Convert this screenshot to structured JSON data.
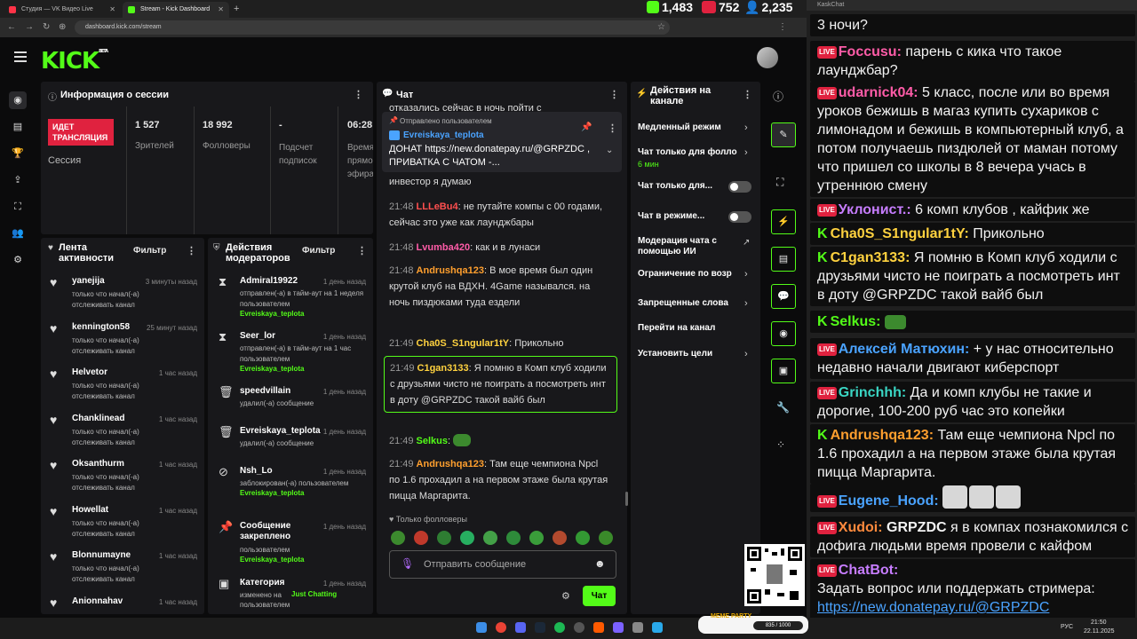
{
  "browser": {
    "tabs": [
      {
        "label": "Студия — VK Видео Live"
      },
      {
        "label": "Stream - Kick Dashboard"
      }
    ],
    "url": "dashboard.kick.com/stream"
  },
  "stats": {
    "kick": "1,483",
    "vk": "752",
    "viewers": "2,235"
  },
  "kick": {
    "logo": "KICK",
    "logo_sup": "BETA"
  },
  "session": {
    "title": "Информация о сессии",
    "status": "ИДЕТ ТРАНСЛЯЦИЯ",
    "status_label": "Сессия",
    "viewers": "1 527",
    "viewers_label": "Зрителей",
    "followers": "18 992",
    "followers_label": "Фолловеры",
    "subs": "-",
    "subs_label": "Подсчет подписок",
    "time": "06:28",
    "time_label": "Время прямого эфира"
  },
  "activity": {
    "title": "Лента активности",
    "filter": "Фильтр",
    "items": [
      {
        "name": "yanejija",
        "time": "3 минуты назад",
        "desc": "только что начал(-а) отслеживать канал"
      },
      {
        "name": "kennington58",
        "time": "25 минут назад",
        "desc": "только что начал(-а) отслеживать канал"
      },
      {
        "name": "Helvetor",
        "time": "1 час назад",
        "desc": "только что начал(-а) отслеживать канал"
      },
      {
        "name": "Chanklinead",
        "time": "1 час назад",
        "desc": "только что начал(-а) отслеживать канал"
      },
      {
        "name": "Oksanthurm",
        "time": "1 час назад",
        "desc": "только что начал(-а) отслеживать канал"
      },
      {
        "name": "Howellat",
        "time": "1 час назад",
        "desc": "только что начал(-а) отслеживать канал"
      },
      {
        "name": "Blonnumayne",
        "time": "1 час назад",
        "desc": "только что начал(-а) отслеживать канал"
      },
      {
        "name": "Anionnahav",
        "time": "1 час назад",
        "desc": ""
      }
    ]
  },
  "modactions": {
    "title": "Действия модераторов",
    "filter": "Фильтр",
    "items": [
      {
        "name": "Admiral19922",
        "time": "1 день назад",
        "desc": "отправлен(-а) в тайм-аут на 1 неделя пользователем",
        "by": "Evreiskaya_teplota"
      },
      {
        "name": "Seer_lor",
        "time": "1 день назад",
        "desc": "отправлен(-а) в тайм-аут на 1 час пользователем",
        "by": "Evreiskaya_teplota"
      },
      {
        "name": "speedvillain",
        "time": "1 день назад",
        "desc": "удалил(-а) сообщение",
        "by": ""
      },
      {
        "name": "Evreiskaya_teplota",
        "time": "1 день назад",
        "desc": "удалил(-а) сообщение",
        "by": ""
      },
      {
        "name": "Nsh_Lo",
        "time": "1 день назад",
        "desc": "заблокирован(-а) пользователем",
        "by": "Evreiskaya_teplota"
      },
      {
        "name": "Сообщение закреплено",
        "time": "1 день назад",
        "desc": "пользователем",
        "by": "Evreiskaya_teplota"
      },
      {
        "name": "Категория",
        "time": "1 день назад",
        "desc": "изменено на",
        "by": "Just Chatting",
        "desc2": "пользователем"
      }
    ]
  },
  "chat": {
    "title": "Чат",
    "pinned_label": "Отправлено пользователем",
    "pinned_user": "Evreiskaya_teplota",
    "pinned_text": "ДОНАТ https://new.donatepay.ru/@GRPZDC , ПРИВАТКА С ЧАТОМ -...",
    "top_partial": "отказались сейчас в ночь пойти с",
    "investor": "инвестор я думаю",
    "messages": [
      {
        "time": "21:48",
        "user": "LLLeBu4",
        "color": "#ff4f4f",
        "text": "не путайте компы с 00 годами, сейчас это уже как лаунджбары"
      },
      {
        "time": "21:48",
        "user": "Lvumba420",
        "color": "#ff5ca8",
        "text": "как и в лунаси"
      },
      {
        "time": "21:48",
        "user": "Andrushqa123",
        "color": "#ff9f2e",
        "text": "В мое время был один крутой клуб на ВДХН. 4Game назывался. на ночь пиздюками туда ездели"
      },
      {
        "time": "21:49",
        "user": "Cha0S_S1ngular1tY",
        "color": "#ffd23f",
        "text": "Прикольно"
      },
      {
        "time": "21:49",
        "user": "C1gan3133",
        "color": "#ffd23f",
        "text": "Я помню в Комп клуб ходили с друзьями чисто не поиграть а посмотреть инт в доту @GRPZDC такой вайб был"
      },
      {
        "time": "21:49",
        "user": "Selkus",
        "color": "#53fc18",
        "text": ""
      },
      {
        "time": "21:49",
        "user": "Andrushqa123",
        "color": "#ff9f2e",
        "text": "Там еще чемпиона Npcl по 1.6 прохадил а на первом этаже была крутая пицца Маргарита."
      }
    ],
    "followers_only": "Только фолловеры",
    "input_placeholder": "Отправить сообщение",
    "send_label": "Чат"
  },
  "channel_actions": {
    "title": "Действия на канале",
    "items": [
      {
        "label": "Медленный режим",
        "sub": ""
      },
      {
        "label": "Чат только для фолло",
        "sub": "6 мин"
      },
      {
        "label": "Чат только для...",
        "sub": ""
      },
      {
        "label": "Чат в режиме...",
        "sub": ""
      },
      {
        "label": "Модерация чата с помощью ИИ",
        "sub": ""
      },
      {
        "label": "Ограничение по возр",
        "sub": ""
      },
      {
        "label": "Запрещенные слова",
        "sub": ""
      },
      {
        "label": "Перейти на канал",
        "sub": ""
      },
      {
        "label": "Установить цели",
        "sub": ""
      }
    ]
  },
  "right_chat": {
    "window_title": "KaskChat",
    "messages": [
      {
        "text": "3 ночи?",
        "user": "",
        "color": ""
      },
      {
        "platform": "live",
        "user": "Foccusu",
        "color": "#ff5ca8",
        "text": "парень с кика что такое лаунджбар?"
      },
      {
        "platform": "live",
        "user": "udarnick04",
        "color": "#ff5ca8",
        "text": "5 класс, после или во время уроков бежишь в магаз купить сухариков с лимонадом и бежишь в компьютерный клуб, а потом получаешь пиздюлей от маман потому что пришел со школы в 8 вечера учась в утреннюю смену"
      },
      {
        "platform": "live",
        "user": "Уклонист.",
        "color": "#c77dff",
        "text": "6 комп клубов , кайфик же"
      },
      {
        "platform": "kick",
        "user": "Cha0S_S1ngular1tY",
        "color": "#ffd23f",
        "text": "Прикольно"
      },
      {
        "platform": "kick",
        "user": "C1gan3133",
        "color": "#ffd23f",
        "text": "Я помню в Комп клуб ходили с друзьями чисто не поиграть а посмотреть инт в доту @GRPZDC такой вайб был"
      },
      {
        "platform": "kick",
        "user": "Selkus",
        "color": "#53fc18",
        "text": ""
      },
      {
        "platform": "live",
        "user": "Алексей Матюхин",
        "color": "#4aa3ff",
        "text": "+ у нас относительно недавно начали двигают киберспорт"
      },
      {
        "platform": "live",
        "user": "Grinchhh",
        "color": "#3ad6c4",
        "text": "Да и комп клубы не такие и дорогие, 100-200 руб час это копейки"
      },
      {
        "platform": "kick",
        "user": "Andrushqa123",
        "color": "#ff9f2e",
        "text": "Там еще чемпиона Npcl по 1.6 прохадил а на первом этаже была крутая пицца Маргарита."
      },
      {
        "platform": "live",
        "user": "Eugene_Hood",
        "color": "#4aa3ff",
        "text": ""
      },
      {
        "platform": "live",
        "user": "Xudoi",
        "color": "#ff8a3d",
        "text": "я в компах познакомился с дофига людьми время провели с кайфом",
        "mention": "GRPZDC"
      },
      {
        "platform": "live",
        "user": "ChatBot",
        "color": "#c77dff",
        "text": "Задать вопрос или поддержать стримера:",
        "link": "https://new.donatepay.ru/@GRPZDC"
      }
    ]
  },
  "taskbar": {
    "lang": "РУС",
    "time": "21:50",
    "date": "22.11.2025",
    "meme_party": "MEME PARTY",
    "counter": "835 / 1000"
  }
}
